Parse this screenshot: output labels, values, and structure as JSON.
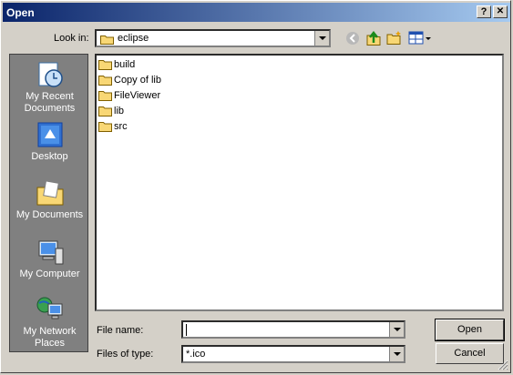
{
  "window": {
    "title": "Open",
    "help_btn": "?",
    "close_btn": "✕"
  },
  "toolbar": {
    "look_in_label": "Look in:",
    "look_in_value": "eclipse"
  },
  "places": [
    {
      "line1": "My Recent",
      "line2": "Documents",
      "icon": "recent-documents-icon"
    },
    {
      "line1": "Desktop",
      "line2": "",
      "icon": "desktop-icon"
    },
    {
      "line1": "My Documents",
      "line2": "",
      "icon": "my-documents-icon"
    },
    {
      "line1": "My Computer",
      "line2": "",
      "icon": "my-computer-icon"
    },
    {
      "line1": "My Network",
      "line2": "Places",
      "icon": "network-places-icon"
    }
  ],
  "files": [
    "build",
    "Copy of lib",
    "FileViewer",
    "lib",
    "src"
  ],
  "form": {
    "file_name_label": "File name:",
    "file_name_value": "",
    "file_type_label": "Files of type:",
    "file_type_value": "*.ico"
  },
  "buttons": {
    "open": "Open",
    "cancel": "Cancel"
  },
  "colors": {
    "title_start": "#0a246a",
    "title_end": "#a6caf0",
    "folder": "#f8d775",
    "places_bg": "#808080"
  }
}
